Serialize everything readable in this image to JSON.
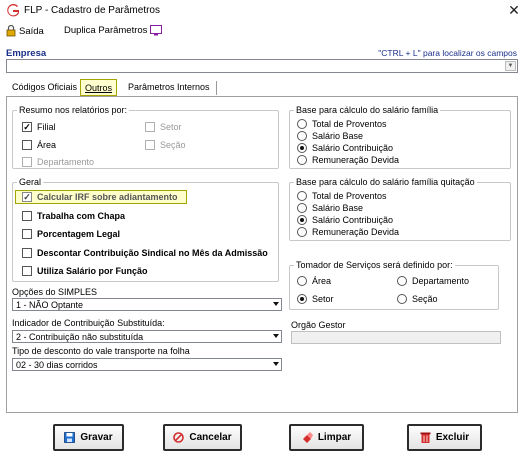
{
  "window": {
    "title": "FLP - Cadastro de Parâmetros",
    "close_glyph": "✕"
  },
  "toolbar": {
    "exit_label": "Saída",
    "duplicate_label": "Duplica Parâmetros"
  },
  "empresa": {
    "label": "Empresa",
    "hint": "\"CTRL + L\" para localizar os campos",
    "value": ""
  },
  "tabs": [
    {
      "label": "Códigos Oficiais",
      "active": false
    },
    {
      "label": "Outros",
      "active": true
    },
    {
      "label": "Parâmetros Internos",
      "active": false
    }
  ],
  "resumo": {
    "legend": "Resumo nos relatórios por:",
    "items": [
      {
        "label": "Filial",
        "checked": true,
        "enabled": true
      },
      {
        "label": "Setor",
        "checked": false,
        "enabled": false
      },
      {
        "label": "Área",
        "checked": false,
        "enabled": true
      },
      {
        "label": "Seção",
        "checked": false,
        "enabled": false
      },
      {
        "label": "Departamento",
        "checked": false,
        "enabled": false
      }
    ]
  },
  "geral": {
    "legend": "Geral",
    "items": [
      {
        "label": "Calcular IRF sobre adiantamento",
        "checked": true
      },
      {
        "label": "Trabalha com Chapa",
        "checked": false
      },
      {
        "label": "Porcentagem Legal",
        "checked": false
      },
      {
        "label": "Descontar Contribuição Sindical no Mês da  Admissão",
        "checked": false
      },
      {
        "label": "Utiliza Salário por Função",
        "checked": false
      }
    ]
  },
  "opcoes_simples": {
    "label": "Opções do SIMPLES",
    "value": "1 - NÃO Optante"
  },
  "indicador": {
    "label": "Indicador de Contribuição Substituída:",
    "value": "2 - Contribuição não substituída"
  },
  "vale_transporte": {
    "label": "Tipo de desconto do vale transporte na folha",
    "value": "02 - 30 dias corridos"
  },
  "base_familia": {
    "legend": "Base para cálculo do salário família",
    "options": [
      "Total de Proventos",
      "Salário Base",
      "Salário Contribuição",
      "Remuneração Devida"
    ],
    "selected": 2
  },
  "base_quitacao": {
    "legend": "Base para cálculo do salário família quitação",
    "options": [
      "Total de Proventos",
      "Salário Base",
      "Salário Contribuição",
      "Remuneração Devida"
    ],
    "selected": 2
  },
  "tomador": {
    "legend": "Tomador de Serviços será definido por:",
    "options": [
      "Área",
      "Departamento",
      "Setor",
      "Seção"
    ],
    "selected": 2
  },
  "orgao_gestor": {
    "label": "Orgão Gestor",
    "value": ""
  },
  "buttons": {
    "save": "Gravar",
    "cancel": "Cancelar",
    "clear": "Limpar",
    "delete": "Excluir"
  },
  "colors": {
    "accent_blue": "#1a2f8a",
    "highlight": "#ffffcc",
    "logo_red": "#d32f2f"
  }
}
